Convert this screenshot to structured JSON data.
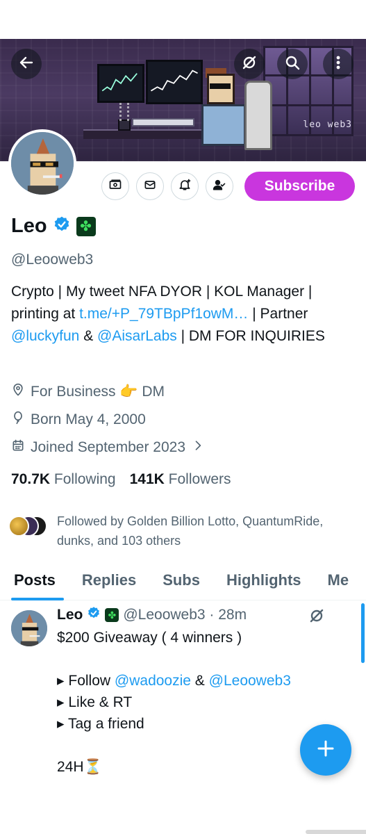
{
  "profile": {
    "name": "Leo",
    "handle": "@Leooweb3",
    "banner_signature": "leo web3",
    "subscribe_label": "Subscribe",
    "bio": {
      "part1": "Crypto | My tweet NFA DYOR | KOL Manager | printing at ",
      "link1": "t.me/+P_79TBpPf1owM…",
      "part2": " | Partner ",
      "mention1": "@luckyfun",
      "part3": " & ",
      "mention2": "@AisarLabs",
      "part4": " | DM FOR INQUIRIES"
    },
    "location": "For Business 👉 DM",
    "born": "Born May 4, 2000",
    "joined": "Joined September 2023",
    "following_count": "70.7K",
    "following_label": "Following",
    "followers_count": "141K",
    "followers_label": "Followers",
    "followed_by": "Followed by Golden Billion Lotto, QuantumRide, dunks, and 103 others"
  },
  "tabs": [
    "Posts",
    "Replies",
    "Subs",
    "Highlights",
    "Me"
  ],
  "tweet": {
    "name": "Leo",
    "handle_time": "@Leooweb3 · 28m",
    "line1": "$200 Giveaway ( 4 winners )",
    "follow_prefix": "▸ Follow ",
    "follow_m1": "@wadoozie",
    "follow_mid": " & ",
    "follow_m2": "@Leooweb3",
    "line_like": "▸ Like & RT",
    "line_tag": "▸ Tag a friend",
    "line_time": "24H⏳"
  },
  "icons": {
    "back": "arrow-left-icon",
    "grok": "grok-icon",
    "search": "search-icon",
    "more": "more-vertical-icon",
    "money": "money-icon",
    "message": "envelope-icon",
    "notify": "bell-plus-icon",
    "following": "person-check-icon",
    "location": "location-pin-icon",
    "birthday": "balloon-icon",
    "calendar": "calendar-icon",
    "compose": "plus-icon"
  },
  "colors": {
    "accent": "#1d9bf0",
    "subscribe": "#c936de",
    "muted": "#536471"
  }
}
